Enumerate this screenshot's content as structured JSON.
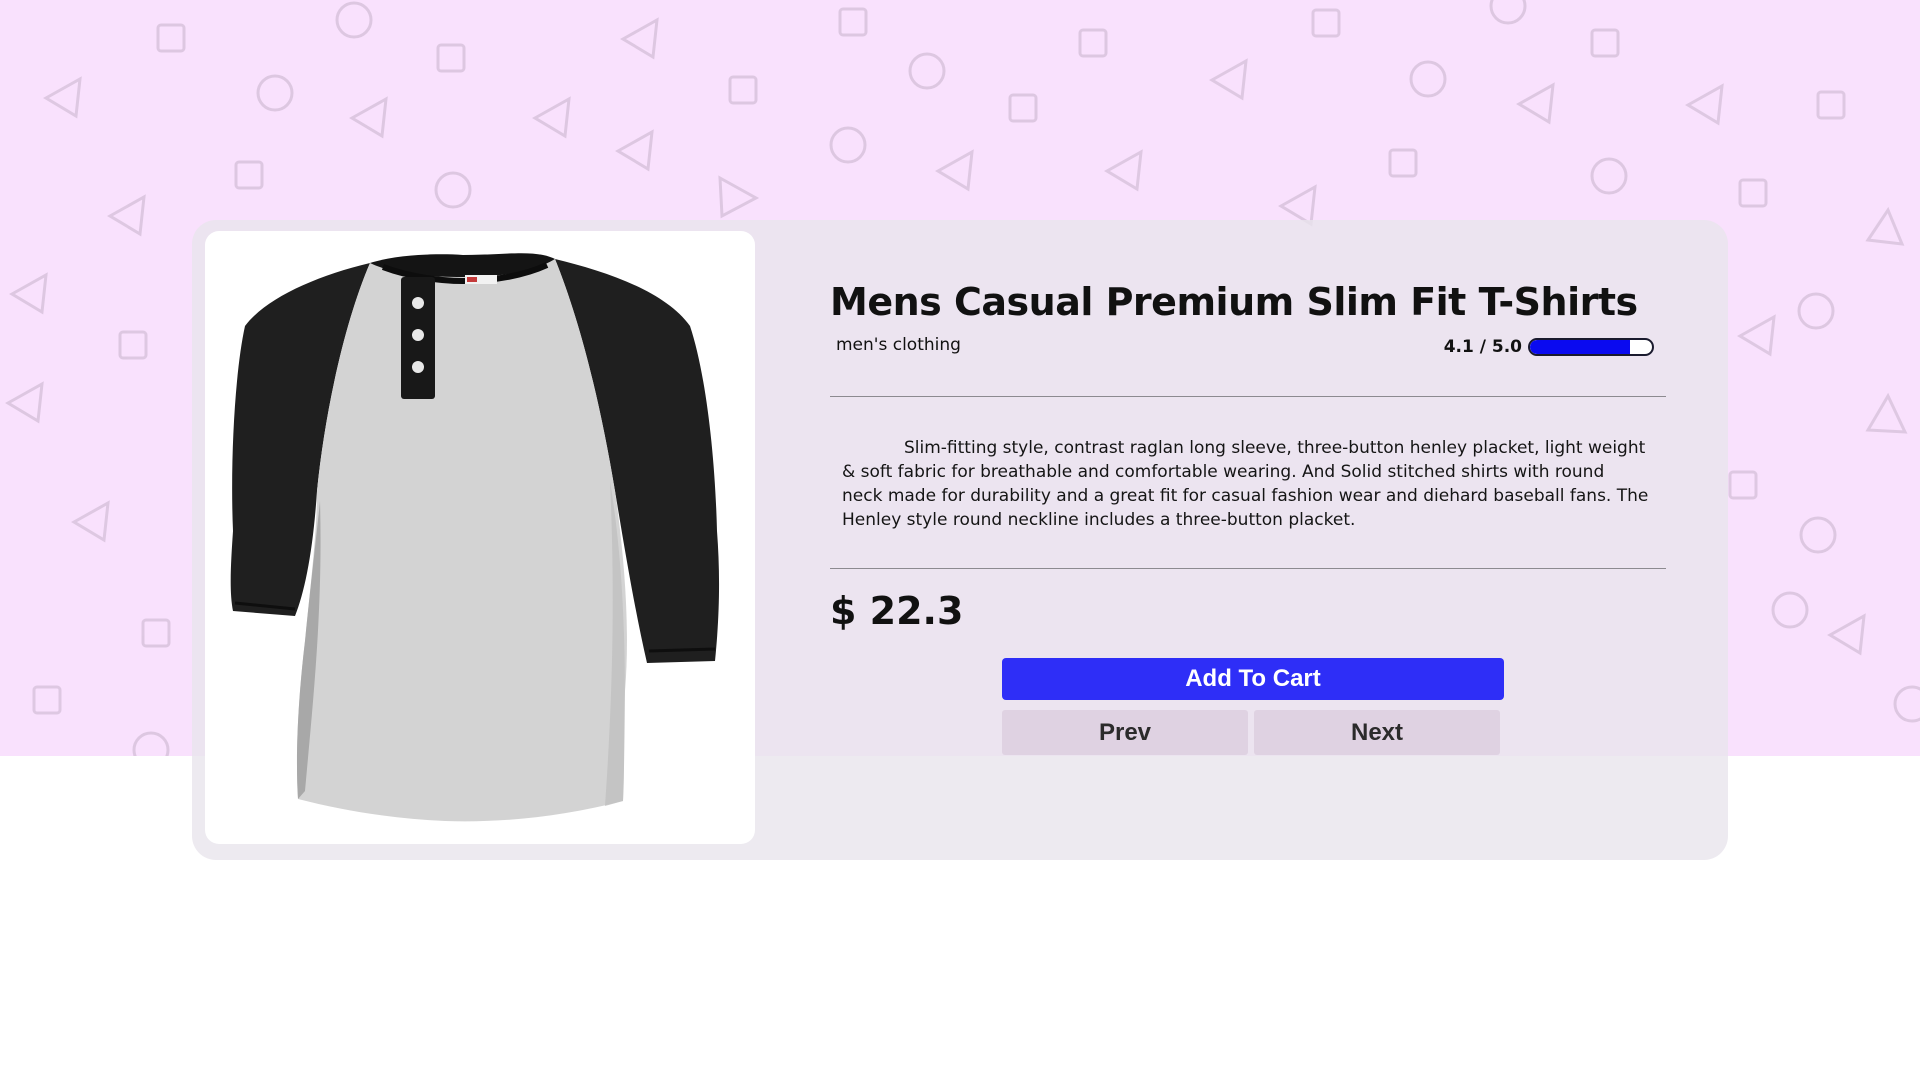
{
  "product": {
    "title": "Mens Casual Premium Slim Fit T-Shirts",
    "category": "men's clothing",
    "rating_text": "4.1 / 5.0",
    "rating_value": 4.1,
    "rating_max": 5.0,
    "description": "Slim-fitting style, contrast raglan long sleeve, three-button henley placket, light weight & soft fabric for breathable and comfortable wearing. And Solid stitched shirts with round neck made for durability and a great fit for casual fashion wear and diehard baseball fans. The Henley style round neckline includes a three-button placket.",
    "price": "$ 22.3",
    "image_icon": "henley-raglan-shirt-image"
  },
  "actions": {
    "add_to_cart_label": "Add To Cart",
    "prev_label": "Prev",
    "next_label": "Next"
  },
  "colors": {
    "background_pink": "#f9e1fd",
    "accent_blue": "#2e2ef7",
    "rating_fill": "#0a0af0",
    "secondary_button": "#dfd2e2"
  }
}
